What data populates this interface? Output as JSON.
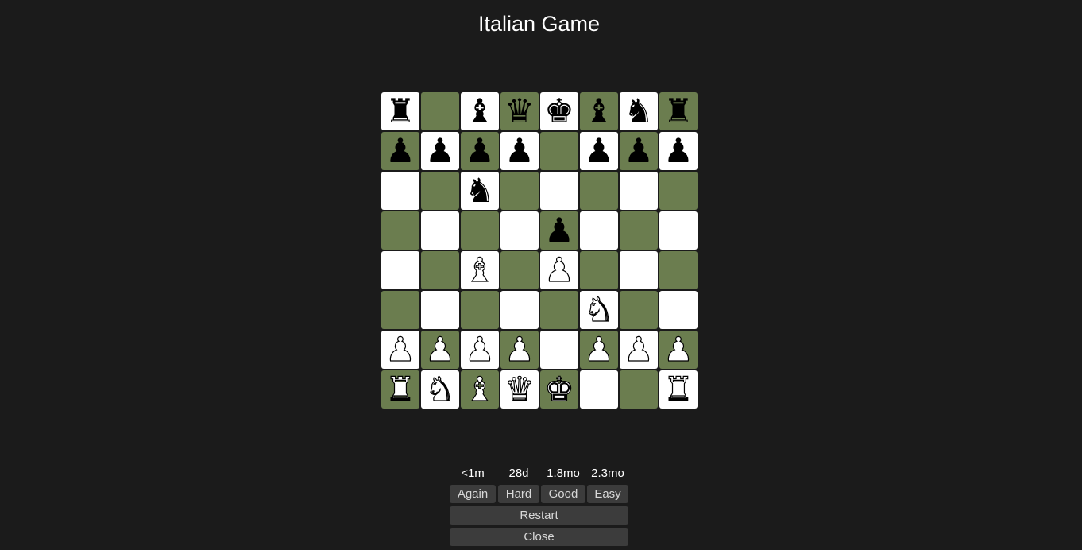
{
  "title": "Italian Game",
  "board": {
    "light_color": "#ffffff",
    "dark_color": "#6b7d4f",
    "ranks": [
      [
        "br",
        "",
        "bb",
        "bq",
        "bk",
        "bb",
        "bn",
        "br"
      ],
      [
        "bp",
        "bp",
        "bp",
        "bp",
        "",
        "bp",
        "bp",
        "bp"
      ],
      [
        "",
        "",
        "bn",
        "",
        "",
        "",
        "",
        ""
      ],
      [
        "",
        "",
        "",
        "",
        "bp",
        "",
        "",
        ""
      ],
      [
        "",
        "",
        "wb",
        "",
        "wp",
        "",
        "",
        ""
      ],
      [
        "",
        "",
        "",
        "",
        "",
        "wn",
        "",
        ""
      ],
      [
        "wp",
        "wp",
        "wp",
        "wp",
        "",
        "wp",
        "wp",
        "wp"
      ],
      [
        "wr",
        "wn",
        "wb",
        "wq",
        "wk",
        "",
        "",
        "wr"
      ]
    ]
  },
  "review": {
    "intervals": {
      "again": "<1m",
      "hard": "28d",
      "good": "1.8mo",
      "easy": "2.3mo"
    },
    "buttons": {
      "again": "Again",
      "hard": "Hard",
      "good": "Good",
      "easy": "Easy"
    }
  },
  "actions": {
    "restart": "Restart",
    "close": "Close"
  }
}
